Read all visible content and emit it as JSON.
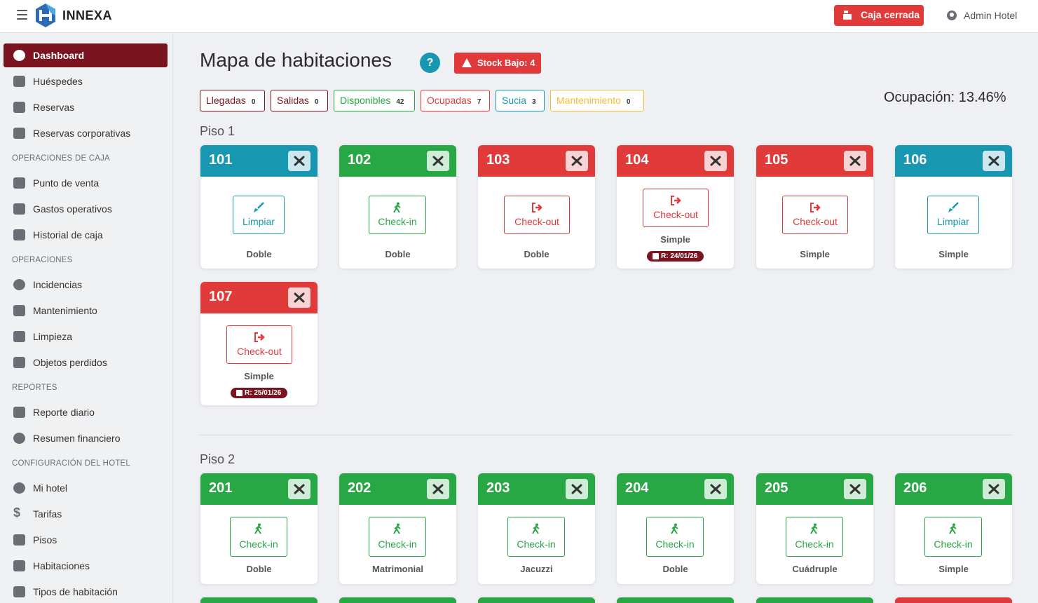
{
  "app": {
    "brand": "INNEXA"
  },
  "topbar": {
    "caja_label": "Caja cerrada",
    "user_label": "Admin Hotel"
  },
  "sidebar": {
    "dashboard": "Dashboard",
    "huespedes": "Huéspedes",
    "reservas": "Reservas",
    "reservas_corp": "Reservas corporativas",
    "sec_caja": "OPERACIONES DE CAJA",
    "punto_venta": "Punto de venta",
    "gastos": "Gastos operativos",
    "historial": "Historial de caja",
    "sec_operaciones": "OPERACIONES",
    "incidencias": "Incidencias",
    "mantenimiento": "Mantenimiento",
    "limpieza": "Limpieza",
    "objetos": "Objetos perdidos",
    "sec_reportes": "REPORTES",
    "reporte_diario": "Reporte diario",
    "resumen": "Resumen financiero",
    "sec_config": "CONFIGURACIÓN DEL HOTEL",
    "mi_hotel": "Mi hotel",
    "tarifas": "Tarifas",
    "pisos": "Pisos",
    "habitaciones": "Habitaciones",
    "tipos": "Tipos de habitación"
  },
  "main": {
    "title": "Mapa de habitaciones",
    "help": "?",
    "stock_label": "Stock Bajo: 4",
    "occupancy": "Ocupación: 13.46%",
    "filters": {
      "llegadas": {
        "label": "Llegadas",
        "count": "0"
      },
      "salidas": {
        "label": "Salidas",
        "count": "0"
      },
      "disponibles": {
        "label": "Disponibles",
        "count": "42"
      },
      "ocupadas": {
        "label": "Ocupadas",
        "count": "7"
      },
      "sucia": {
        "label": "Sucia",
        "count": "3"
      },
      "mantenimiento": {
        "label": "Mantenimiento",
        "count": "0"
      }
    },
    "floor1": "Piso 1",
    "floor2": "Piso 2"
  },
  "rooms": {
    "r101": {
      "number": "101",
      "action": "Limpiar",
      "type": "Doble"
    },
    "r102": {
      "number": "102",
      "action": "Check-in",
      "type": "Doble"
    },
    "r103": {
      "number": "103",
      "action": "Check-out",
      "type": "Doble"
    },
    "r104": {
      "number": "104",
      "action": "Check-out",
      "type": "Simple",
      "reservation": "R: 24/01/26"
    },
    "r105": {
      "number": "105",
      "action": "Check-out",
      "type": "Simple"
    },
    "r106": {
      "number": "106",
      "action": "Limpiar",
      "type": "Simple"
    },
    "r107": {
      "number": "107",
      "action": "Check-out",
      "type": "Simple",
      "reservation": "R: 25/01/26"
    },
    "r201": {
      "number": "201",
      "action": "Check-in",
      "type": "Doble"
    },
    "r202": {
      "number": "202",
      "action": "Check-in",
      "type": "Matrimonial"
    },
    "r203": {
      "number": "203",
      "action": "Check-in",
      "type": "Jacuzzi"
    },
    "r204": {
      "number": "204",
      "action": "Check-in",
      "type": "Doble"
    },
    "r205": {
      "number": "205",
      "action": "Check-in",
      "type": "Cuádruple"
    },
    "r206": {
      "number": "206",
      "action": "Check-in",
      "type": "Simple"
    }
  },
  "colors": {
    "available": "#28a745",
    "occupied": "#e03a3a",
    "dirty": "#1898b0",
    "brand_dark": "#7a1520"
  }
}
